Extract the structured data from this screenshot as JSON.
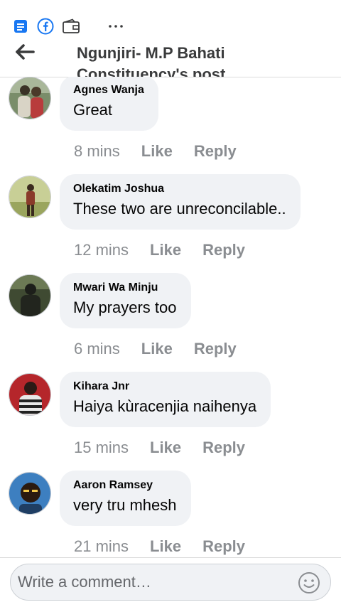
{
  "header": {
    "title_line1": "Ngunjiri- M.P Bahati",
    "title_line2": "Constituency's post"
  },
  "notification_bar": {
    "icons": [
      "notes-icon",
      "facebook-icon",
      "wallet-icon",
      "more-dots-icon"
    ]
  },
  "comments": [
    {
      "author": "Agnes Wanja",
      "text": "Great",
      "time": "8 mins",
      "like": "Like",
      "reply": "Reply",
      "avatar": {
        "bg": "#7a8d6a",
        "fg": "#3a3226"
      }
    },
    {
      "author": "Olekatim Joshua",
      "text": "These two are unreconcilable..",
      "time": "12 mins",
      "like": "Like",
      "reply": "Reply",
      "avatar": {
        "bg": "#b9c07e",
        "fg": "#8a3b2a"
      }
    },
    {
      "author": "Mwari Wa Minju",
      "text": "My prayers too",
      "time": "6 mins",
      "like": "Like",
      "reply": "Reply",
      "avatar": {
        "bg": "#3f4a32",
        "fg": "#1d1f1a"
      }
    },
    {
      "author": "Kihara Jnr",
      "text": "Haiya kùracenjia naihenya",
      "time": "15 mins",
      "like": "Like",
      "reply": "Reply",
      "avatar": {
        "bg": "#b5262b",
        "fg": "#2a1a16"
      }
    },
    {
      "author": "Aaron Ramsey",
      "text": "very tru mhesh",
      "time": "21 mins",
      "like": "Like",
      "reply": "Reply",
      "avatar": {
        "bg": "#3d7fc0",
        "fg": "#2b1a10"
      }
    }
  ],
  "composer": {
    "placeholder": "Write a comment…"
  },
  "colors": {
    "accent": "#1877f2",
    "bubble": "#f0f2f5",
    "meta": "#8a8d91"
  }
}
